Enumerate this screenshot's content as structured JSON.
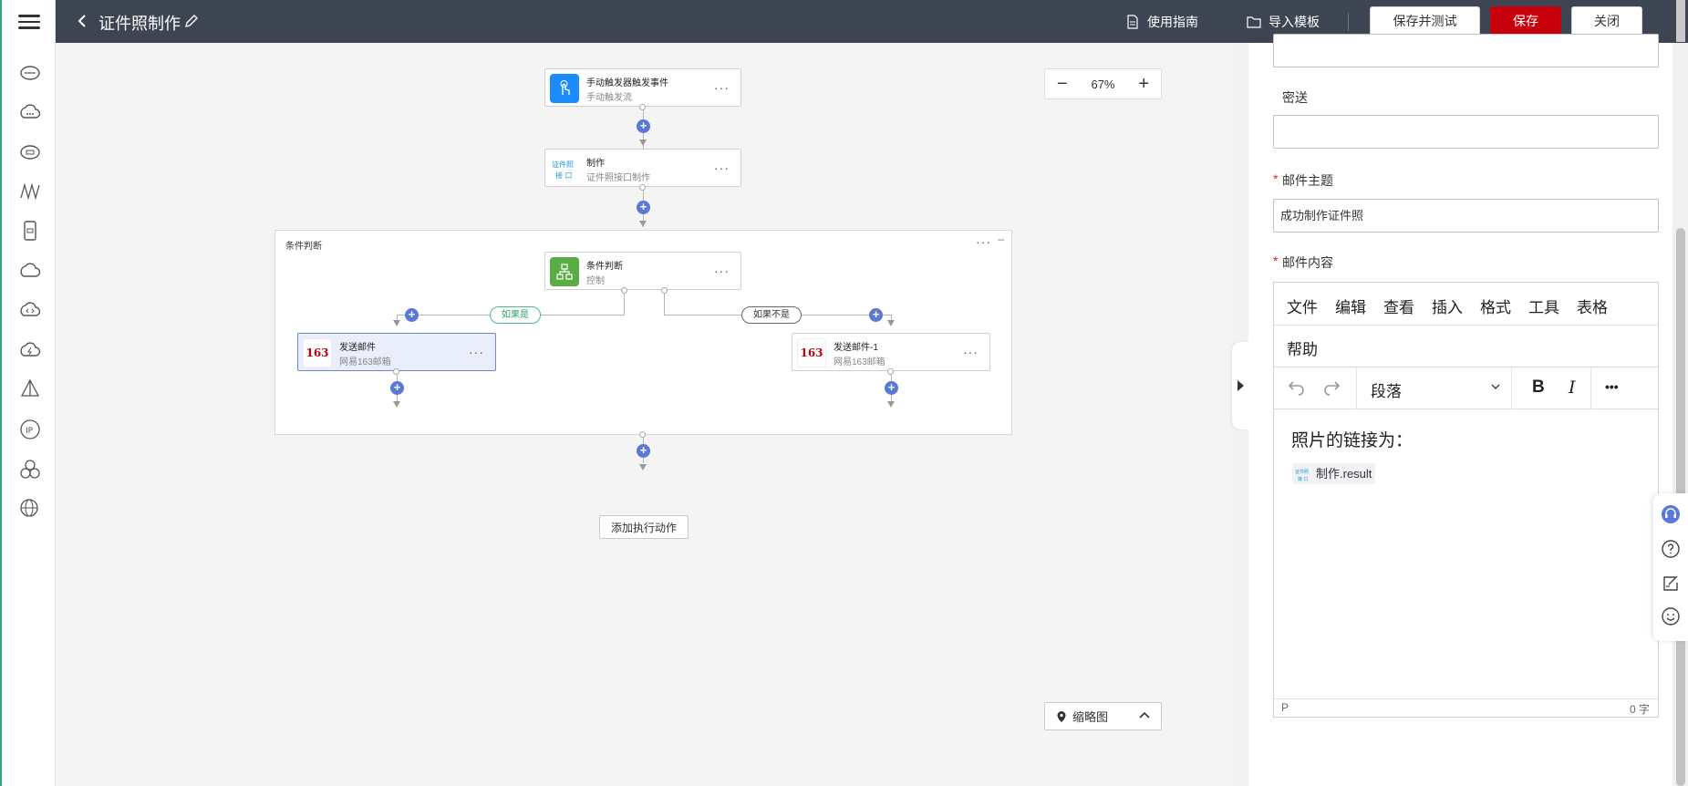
{
  "header": {
    "title": "证件照制作",
    "guide_label": "使用指南",
    "import_label": "导入模板",
    "save_test_label": "保存并测试",
    "save_label": "保存",
    "close_label": "关闭"
  },
  "flow": {
    "trigger": {
      "title": "手动触发器触发事件",
      "subtitle": "手动触发流"
    },
    "make": {
      "title": "制作",
      "subtitle": "证件照接口制作",
      "badge": "证件照\n接 口"
    },
    "condition_group_label": "条件判断",
    "condition": {
      "title": "条件判断",
      "subtitle": "控制"
    },
    "if_yes_label": "如果是",
    "if_no_label": "如果不是",
    "mail_left": {
      "title": "发送邮件",
      "subtitle": "网易163邮箱",
      "badge": "163"
    },
    "mail_right": {
      "title": "发送邮件-1",
      "subtitle": "网易163邮箱",
      "badge": "163"
    },
    "add_action_label": "添加执行动作"
  },
  "canvas_controls": {
    "zoom_level": "67%",
    "zoom_out": "−",
    "zoom_in": "+",
    "minimap_label": "缩略图"
  },
  "panel": {
    "bcc_label": "密送",
    "bcc_value": "",
    "subject_label": "邮件主题",
    "subject_value": "成功制作证件照",
    "content_label": "邮件内容",
    "required_mark": "*",
    "editor_menu": [
      "文件",
      "编辑",
      "查看",
      "插入",
      "格式",
      "工具",
      "表格",
      "帮助"
    ],
    "block_format": "段落",
    "bold_label": "B",
    "italic_label": "I",
    "more_label": "•••",
    "body_text": "照片的链接为：",
    "variable_label": "制作.result",
    "status_path": "P",
    "word_count": "0 字"
  },
  "colors": {
    "header_bg": "#3e4552",
    "save_red": "#c7000b",
    "accent_blue": "#5b78d6",
    "trigger_blue": "#1a8cff",
    "condition_green": "#5aac44"
  }
}
